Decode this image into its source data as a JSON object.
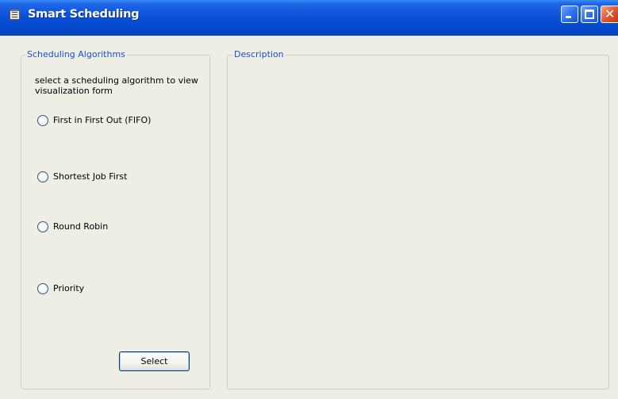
{
  "window": {
    "title": "Smart Scheduling",
    "icon": "document-window-icon",
    "controls": [
      "minimize-icon",
      "maximize-icon",
      "close-icon"
    ]
  },
  "algorithms": {
    "group_title": "Scheduling Algorithms",
    "instructions": "select a scheduling algorithm to view visualization form",
    "options": [
      {
        "label": "First in First Out (FIFO)",
        "selected": false
      },
      {
        "label": "Shortest Job First",
        "selected": false
      },
      {
        "label": "Round Robin",
        "selected": false
      },
      {
        "label": "Priority",
        "selected": false
      }
    ],
    "select_button": "Select"
  },
  "description": {
    "group_title": "Description",
    "text": ""
  },
  "colors": {
    "titlebar": "#0a4fd8",
    "window_background": "#efeee5",
    "group_title": "#1c4fd0",
    "close_button": "#e0532c"
  }
}
